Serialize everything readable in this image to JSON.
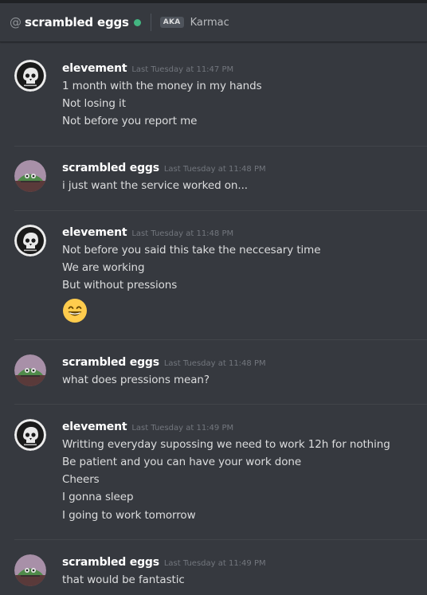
{
  "header": {
    "at_symbol": "@",
    "channel_name": "scrambled eggs",
    "status": "online",
    "aka_badge": "AKA",
    "aka_name": "Karmac"
  },
  "colors": {
    "background": "#36393f",
    "online": "#43b581",
    "author": "#ffffff",
    "timestamp": "#72767d",
    "text": "#dcddde"
  },
  "messages": [
    {
      "author": "elevement",
      "avatar": "skull-avatar",
      "timestamp": "Last Tuesday at 11:47 PM",
      "lines": [
        "1 month with the money in my hands",
        "Not losing it",
        "Not before you report me"
      ]
    },
    {
      "author": "scrambled eggs",
      "avatar": "frog-avatar",
      "timestamp": "Last Tuesday at 11:48 PM",
      "lines": [
        "i just want the service worked on..."
      ]
    },
    {
      "author": "elevement",
      "avatar": "skull-avatar",
      "timestamp": "Last Tuesday at 11:48 PM",
      "lines": [
        "Not before you said this take the neccesary time",
        "We are working",
        "But without pressions"
      ],
      "emoji": "grinning-face-emoji"
    },
    {
      "author": "scrambled eggs",
      "avatar": "frog-avatar",
      "timestamp": "Last Tuesday at 11:48 PM",
      "lines": [
        "what does pressions mean?"
      ]
    },
    {
      "author": "elevement",
      "avatar": "skull-avatar",
      "timestamp": "Last Tuesday at 11:49 PM",
      "lines": [
        "Writting everyday supossing we need to work 12h for nothing",
        "Be patient and you can have your work done",
        "Cheers",
        "I gonna sleep",
        "I going to work tomorrow"
      ]
    },
    {
      "author": "scrambled eggs",
      "avatar": "frog-avatar",
      "timestamp": "Last Tuesday at 11:49 PM",
      "lines": [
        "that would be fantastic"
      ]
    }
  ]
}
